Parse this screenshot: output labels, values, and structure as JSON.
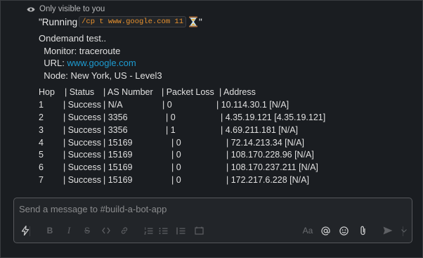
{
  "ephemeral_note": "Only visible to you",
  "running": {
    "prefix": "\"Running",
    "command": "/cp t www.google.com 11",
    "suffix": "\""
  },
  "message": {
    "title": "Ondemand test..",
    "monitor": "  Monitor: traceroute",
    "url_label": "  URL: ",
    "url": "www.google.com",
    "node": "  Node: New York, US - Level3"
  },
  "table": {
    "headers": [
      "Hop",
      "| Status",
      "| AS Number",
      "| Packet Loss",
      "| Address"
    ],
    "rows": [
      [
        "1",
        "| Success",
        "| N/A",
        "| 0",
        "| 10.114.30.1 [N/A]"
      ],
      [
        "2",
        "| Success",
        "| 3356",
        "| 0",
        "| 4.35.19.121 [4.35.19.121]"
      ],
      [
        "3",
        "| Success",
        "| 3356",
        "| 1",
        "| 4.69.211.181 [N/A]"
      ],
      [
        "4",
        "| Success",
        "| 15169",
        "| 0",
        "| 72.14.213.34 [N/A]"
      ],
      [
        "5",
        "| Success",
        "| 15169",
        "| 0",
        "| 108.170.228.96 [N/A]"
      ],
      [
        "6",
        "| Success",
        "| 15169",
        "| 0",
        "| 108.170.237.211 [N/A]"
      ],
      [
        "7",
        "| Success",
        "| 15169",
        "| 0",
        "| 172.217.6.228 [N/A]"
      ]
    ]
  },
  "composer": {
    "placeholder": "Send a message to #build-a-bot-app",
    "format_label": "Aa"
  },
  "icons": [
    "eye-icon",
    "hourglass-icon",
    "shortcuts-icon",
    "bold-icon",
    "italic-icon",
    "strikethrough-icon",
    "code-icon",
    "link-icon",
    "ordered-list-icon",
    "bulleted-list-icon",
    "blockquote-icon",
    "code-block-icon",
    "mention-icon",
    "emoji-icon",
    "attachment-icon",
    "send-icon",
    "send-options-icon"
  ]
}
